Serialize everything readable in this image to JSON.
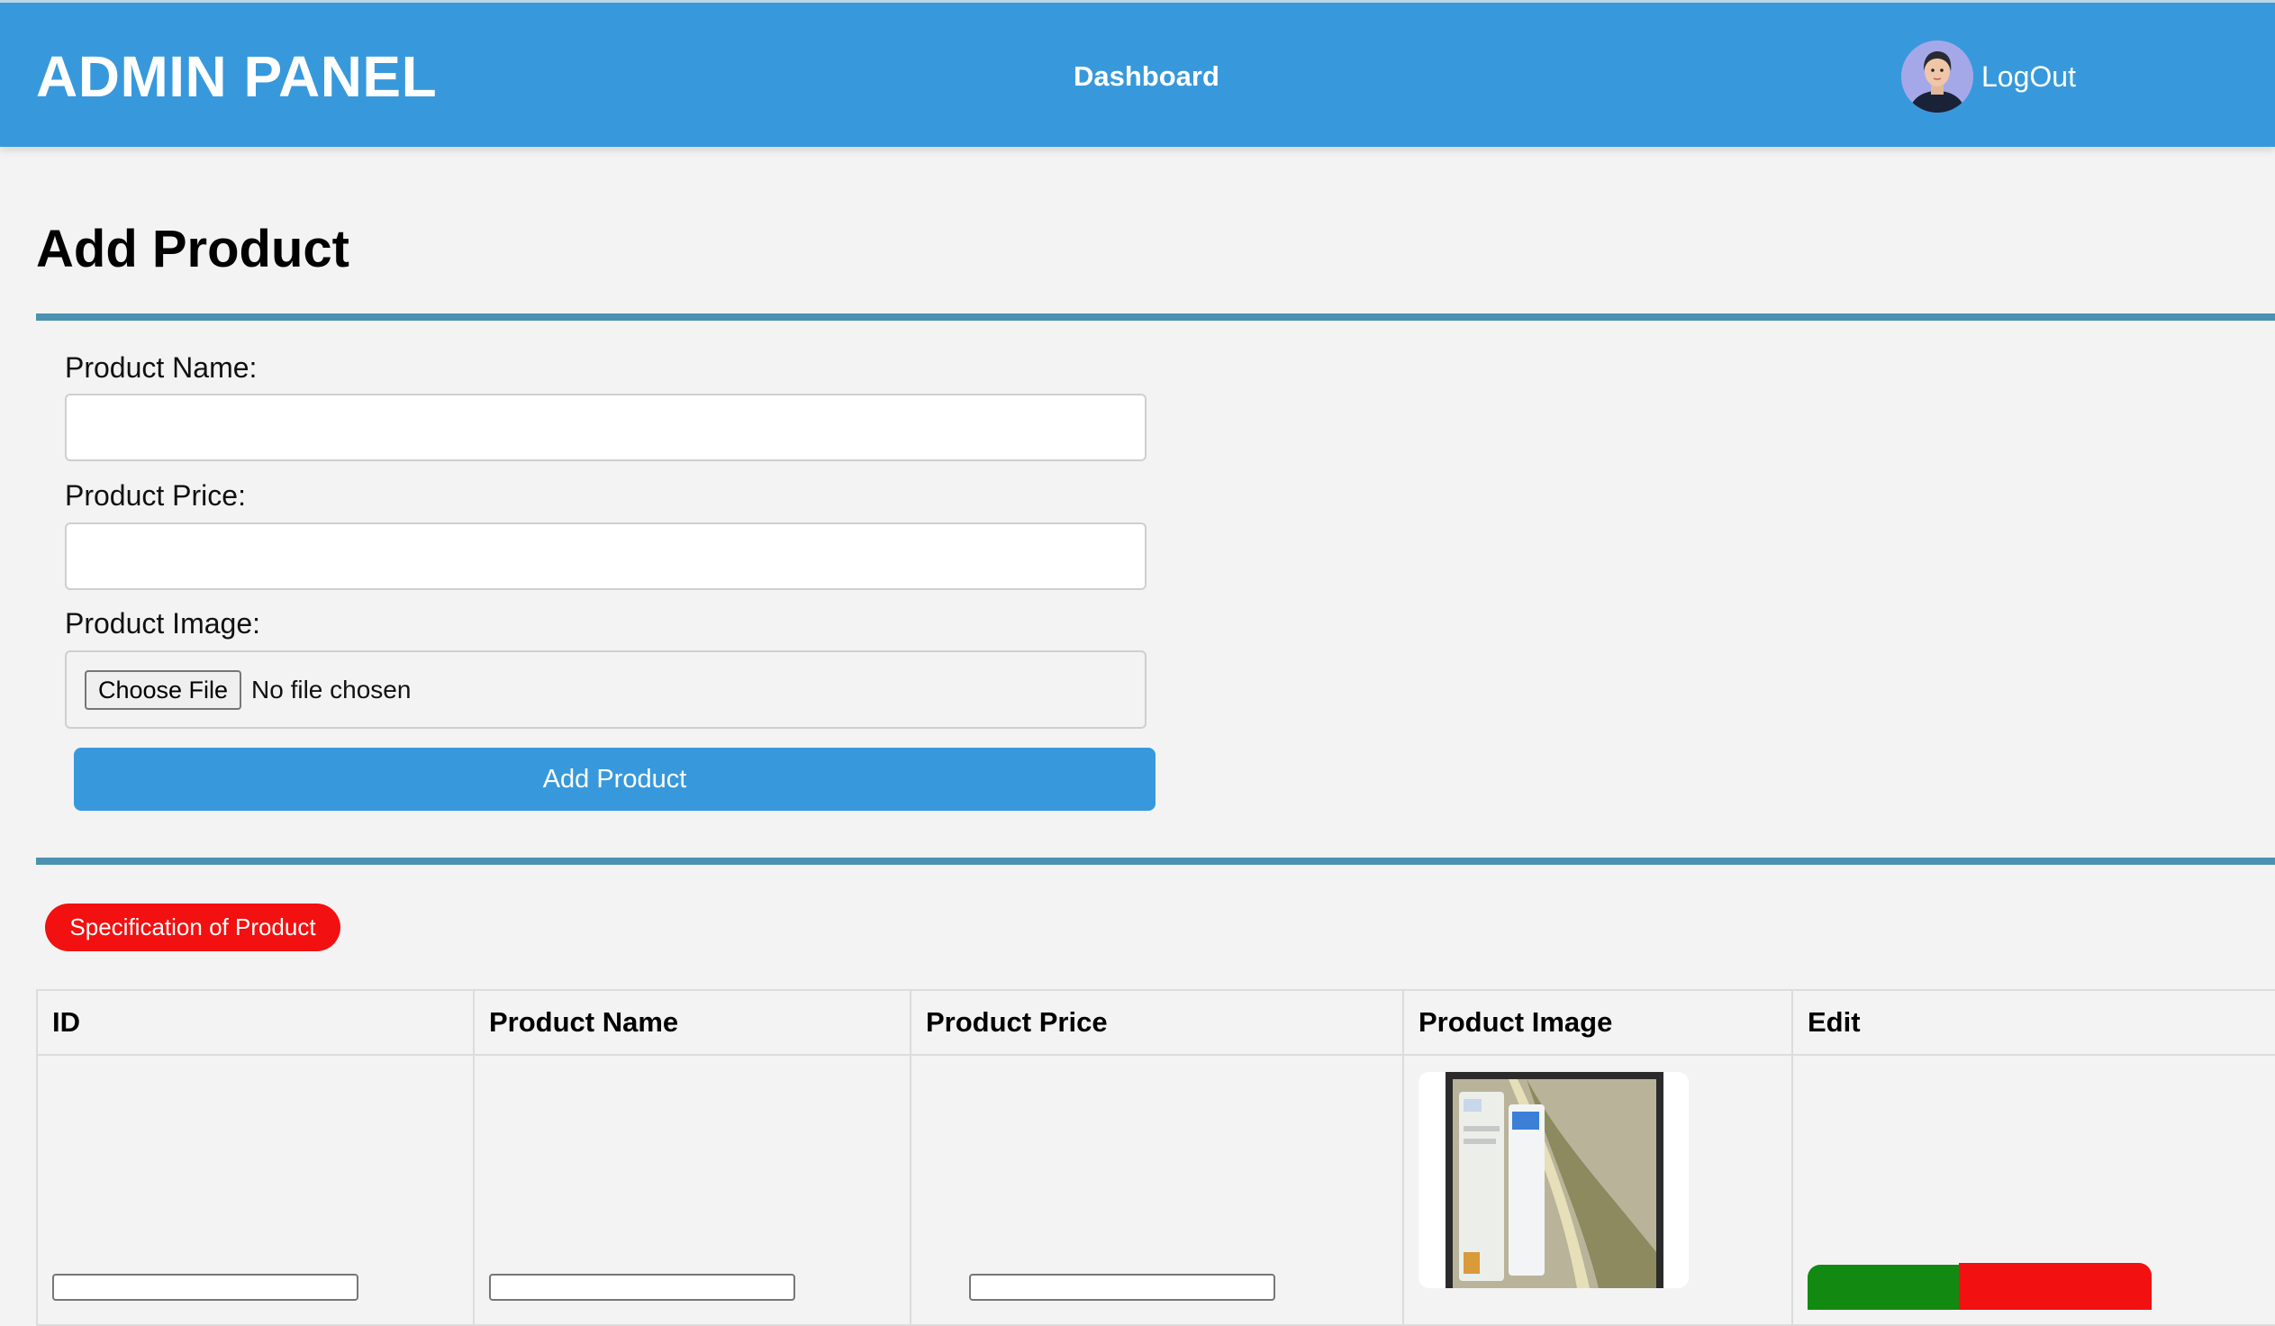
{
  "header": {
    "brand": "ADMIN PANEL",
    "nav_dashboard": "Dashboard",
    "logout": "LogOut",
    "bg_color": "#3799db"
  },
  "form": {
    "title": "Add Product",
    "name_label": "Product Name:",
    "name_value": "",
    "price_label": "Product Price:",
    "price_value": "",
    "image_label": "Product Image:",
    "choose_file": "Choose File",
    "file_status": "No file chosen",
    "submit": "Add Product"
  },
  "spec_badge": "Specification of Product",
  "table": {
    "headers": [
      "ID",
      "Product Name",
      "Product Price",
      "Product Image",
      "Edit"
    ]
  },
  "colors": {
    "accent": "#3799db",
    "rule": "#4b91b2",
    "badge": "#f21010",
    "edit": "#128a12",
    "delete": "#f21010"
  }
}
